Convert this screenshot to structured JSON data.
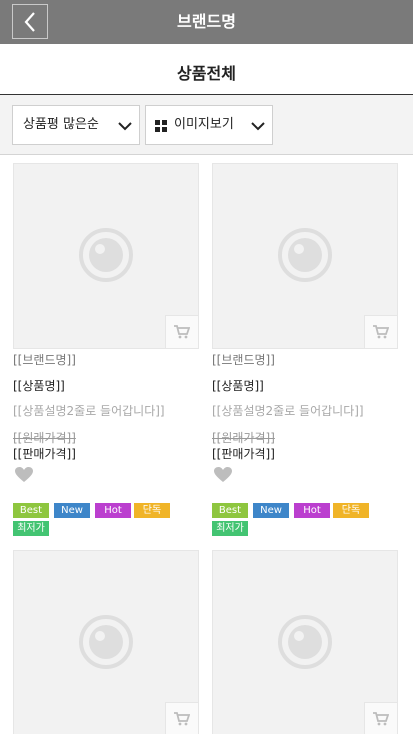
{
  "header": {
    "title": "브랜드명",
    "back_icon": "chevron-left-icon"
  },
  "page": {
    "title": "상품전체"
  },
  "filters": {
    "sort_value": "상품평 많은순",
    "view_value": "이미지보기",
    "view_icon": "grid-icon"
  },
  "product_template": {
    "brand": "[[브랜드명]]",
    "name": "[[상품명]]",
    "description": "[[상품설명2줄로 들어갑니다]]",
    "original_price": "[[원래가격]]",
    "sale_price": "[[판매가격]]",
    "badges": [
      "Best",
      "New",
      "Hot",
      "단독",
      "최저가"
    ]
  },
  "colors": {
    "header_bg": "#7a7a7a",
    "badge_best": "#8ec63f",
    "badge_new": "#3e86c9",
    "badge_hot": "#bb3fcf",
    "badge_exclusive": "#f0b428",
    "badge_lowest": "#43c472"
  }
}
